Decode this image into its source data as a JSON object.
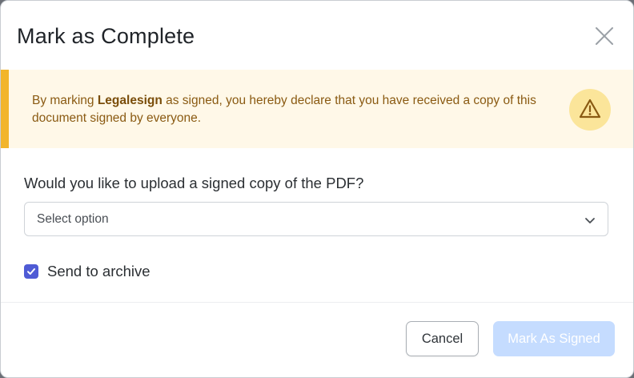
{
  "dialog": {
    "title": "Mark as Complete",
    "close_label": "close"
  },
  "alert": {
    "text_before": "By marking ",
    "document_name": "Legalesign",
    "text_after": " as signed, you hereby declare that you have received a copy of this document signed by everyone.",
    "icon": "warning-icon",
    "accent_color": "#f2b52b",
    "background_color": "#fff8e8"
  },
  "upload": {
    "question": "Would you like to upload a signed copy of the PDF?",
    "select_value": "Select option"
  },
  "archive": {
    "label": "Send to archive",
    "checked": true,
    "checkbox_color": "#4f5bd5"
  },
  "footer": {
    "cancel_label": "Cancel",
    "primary_label": "Mark As Signed",
    "primary_enabled": false,
    "primary_color": "#c5dcff"
  }
}
